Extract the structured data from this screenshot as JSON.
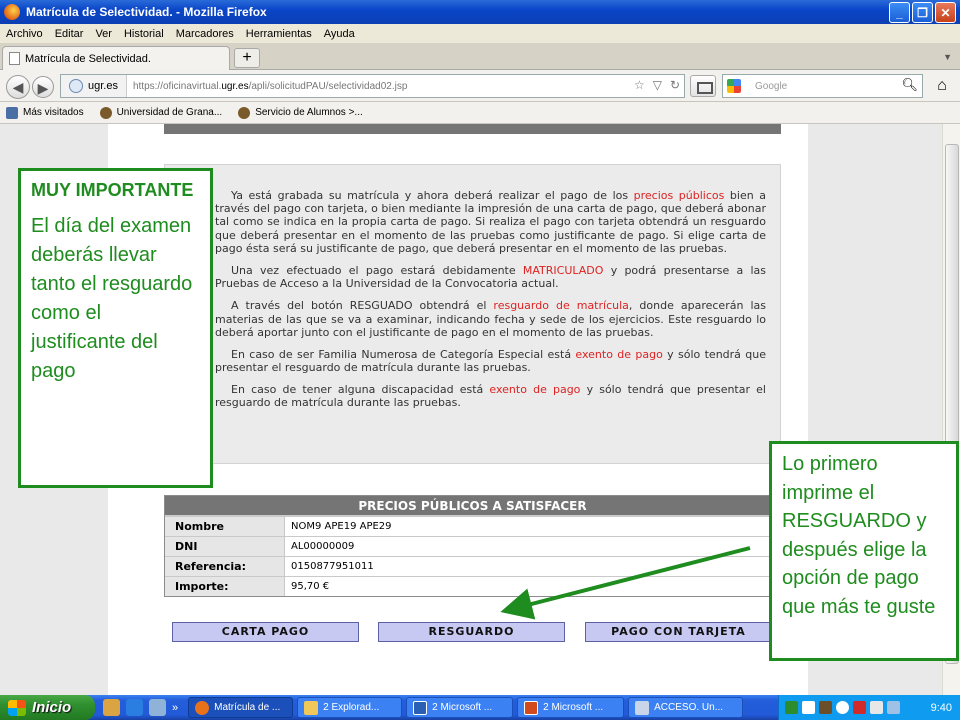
{
  "window": {
    "title": "Matrícula de Selectividad. - Mozilla Firefox"
  },
  "menu": [
    "Archivo",
    "Editar",
    "Ver",
    "Historial",
    "Marcadores",
    "Herramientas",
    "Ayuda"
  ],
  "tab": {
    "label": "Matrícula de Selectividad."
  },
  "nav": {
    "site_identity": "ugr.es",
    "url_prefix": "https://oficinavirtual.",
    "url_domain": "ugr.es",
    "url_path": "/apli/solicitudPAU/selectividad02.jsp",
    "search_placeholder": "Google"
  },
  "bookmarks": [
    "Más visitados",
    "Universidad de Grana...",
    "Servicio de Alumnos >..."
  ],
  "content": {
    "p1": {
      "before": "Ya está grabada su matrícula y ahora deberá realizar el pago de los ",
      "link": "precios públicos",
      "after": " bien a través del pago con tarjeta, o bien mediante la impresión de una carta de pago, que deberá abonar tal como se indica en la propia carta de pago. Si realiza el pago con tarjeta obtendrá un resguardo que deberá presentar en el momento de las pruebas como justificante de pago. Si elige carta de pago ésta será su justificante de pago, que deberá presentar en el momento de las pruebas."
    },
    "p2": {
      "before": "Una vez efectuado el pago estará debidamente ",
      "link": "MATRICULADO",
      "after": " y podrá presentarse a las Pruebas de Acceso a la Universidad de la Convocatoria actual."
    },
    "p3": {
      "before": "A través del botón RESGUADO obtendrá el ",
      "link": "resguardo de matrícula",
      "after": ", donde aparecerán las materias de las que se va a examinar, indicando fecha y sede de los ejercicios. Este resguardo lo deberá aportar junto con el justificante de pago en el momento de las pruebas."
    },
    "p4": {
      "before": "En caso de ser Familia Numerosa de Categoría Especial está ",
      "link": "exento de pago",
      "after": " y sólo tendrá que presentar el resguardo de matrícula durante las pruebas."
    },
    "p5": {
      "before": "En caso de tener alguna discapacidad está ",
      "link": "exento de pago",
      "after": " y sólo tendrá que presentar el resguardo de matrícula durante las pruebas."
    }
  },
  "prices": {
    "title": "PRECIOS PÚBLICOS A SATISFACER",
    "rows": [
      {
        "label": "Nombre",
        "value": "NOM9 APE19 APE29"
      },
      {
        "label": "DNI",
        "value": "AL00000009"
      },
      {
        "label": "Referencia:",
        "value": "0150877951011"
      },
      {
        "label": "Importe:",
        "value": "95,70 €"
      }
    ]
  },
  "buttons": {
    "carta_pago": "CARTA PAGO",
    "resguardo": "RESGUARDO",
    "pago_tarjeta": "PAGO CON TARJETA"
  },
  "notes": {
    "left_title": "MUY IMPORTANTE",
    "left_body": "El día del examen deberás llevar tanto el resguardo como el justificante del pago",
    "right_body": "Lo primero imprime el RESGUARDO y después elige la opción de pago que más te guste"
  },
  "taskbar": {
    "start": "Inicio",
    "tasks": [
      "Matrícula de ...",
      "2 Explorad...",
      "2 Microsoft ...",
      "2 Microsoft ...",
      "ACCESO. Un..."
    ],
    "clock": "9:40"
  },
  "colors": {
    "note_green": "#1f8c1f",
    "link_red": "#dd2222",
    "button_fill": "#c7c9f2"
  }
}
